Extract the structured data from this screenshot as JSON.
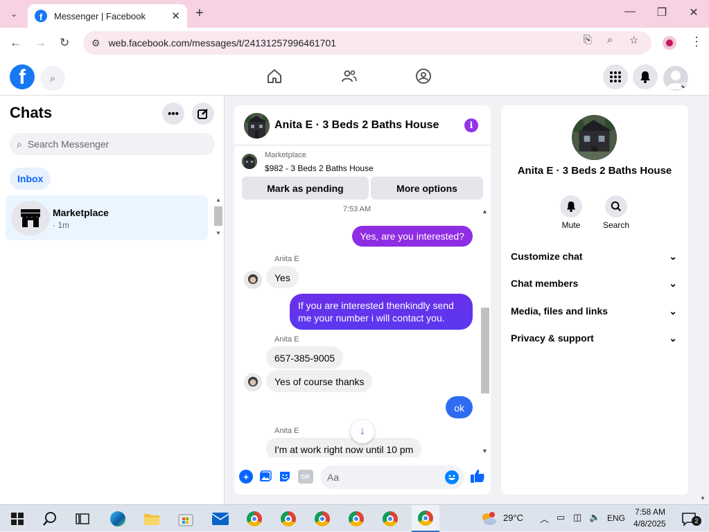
{
  "browser": {
    "tab_title": "Messenger | Facebook",
    "url": "web.facebook.com/messages/t/24131257996461701",
    "new_tab": "+",
    "tab_close": "✕",
    "minimize": "—",
    "maximize": "❐",
    "close": "✕",
    "back": "←",
    "forward": "→",
    "reload": "↻"
  },
  "sidebar": {
    "title": "Chats",
    "search_placeholder": "Search Messenger",
    "filter": "Inbox",
    "conversations": [
      {
        "name": "Marketplace",
        "time": "· 1m"
      }
    ]
  },
  "chat": {
    "title": "Anita E · 3 Beds 2 Baths House",
    "listing_label": "Marketplace",
    "listing_price": "$982 - 3 Beds 2 Baths House",
    "mark_pending": "Mark as pending",
    "more_options": "More options",
    "timestamp": "7:53 AM",
    "messages": [
      {
        "from": "me",
        "text": "Yes, are you interested?"
      },
      {
        "from": "Anita E",
        "text": "Yes"
      },
      {
        "from": "me",
        "text": "If you are interested thenkindly send me your number i will contact you."
      },
      {
        "from": "Anita E",
        "text": "657-385-9005"
      },
      {
        "from": "Anita E",
        "text": "Yes of course thanks"
      },
      {
        "from": "me",
        "text": "ok"
      },
      {
        "from": "Anita E",
        "text": "I'm at work right now until 10 pm"
      }
    ],
    "sender_label": "Anita E",
    "composer_placeholder": "Aa",
    "gif_label": "GIF"
  },
  "details": {
    "name": "Anita E · 3 Beds 2 Baths House",
    "mute": "Mute",
    "search": "Search",
    "sections": [
      "Customize chat",
      "Chat members",
      "Media, files and links",
      "Privacy & support"
    ]
  },
  "taskbar": {
    "weather": "29°C",
    "language": "ENG",
    "time": "7:58 AM",
    "date": "4/8/2025",
    "notifications": "2"
  },
  "colors": {
    "accent_purple": "#9333ea",
    "bubble_gradient_top": "#8a2be2",
    "bubble_gradient_bottom": "#1f6ff5",
    "facebook_blue": "#1877f2"
  }
}
